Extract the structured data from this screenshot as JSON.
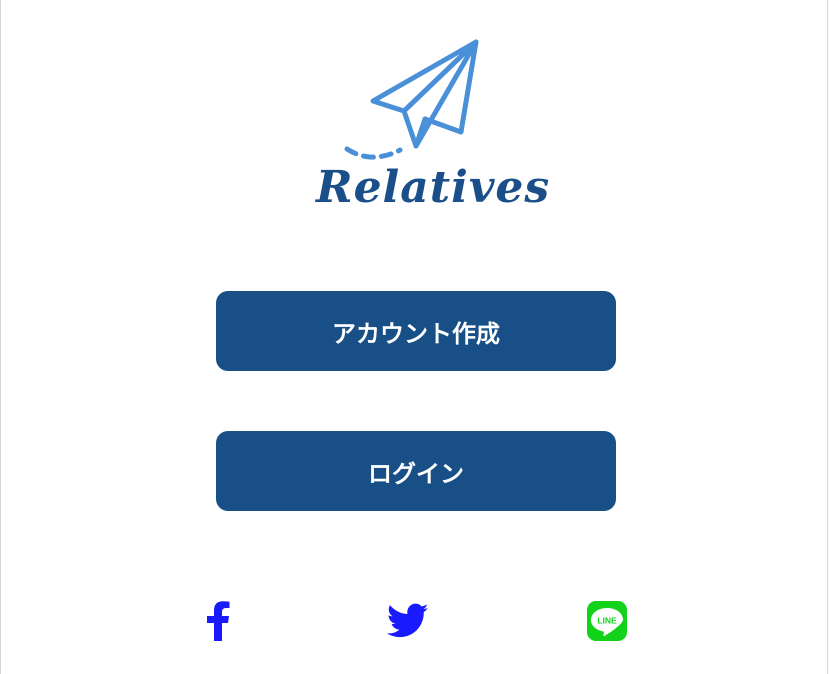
{
  "brand": {
    "name": "Relatives",
    "logo_icon": "paper-plane-icon",
    "logo_color": "#4a90d9",
    "wordmark_color": "#1b4f8a"
  },
  "actions": {
    "create_account_label": "アカウント作成",
    "login_label": "ログイン",
    "button_color": "#174f86"
  },
  "social": {
    "facebook": {
      "icon": "facebook-icon",
      "color": "#1a1aff"
    },
    "twitter": {
      "icon": "twitter-icon",
      "color": "#1a1aff"
    },
    "line": {
      "icon": "line-icon",
      "text": "LINE",
      "color": "#12d21a"
    }
  }
}
